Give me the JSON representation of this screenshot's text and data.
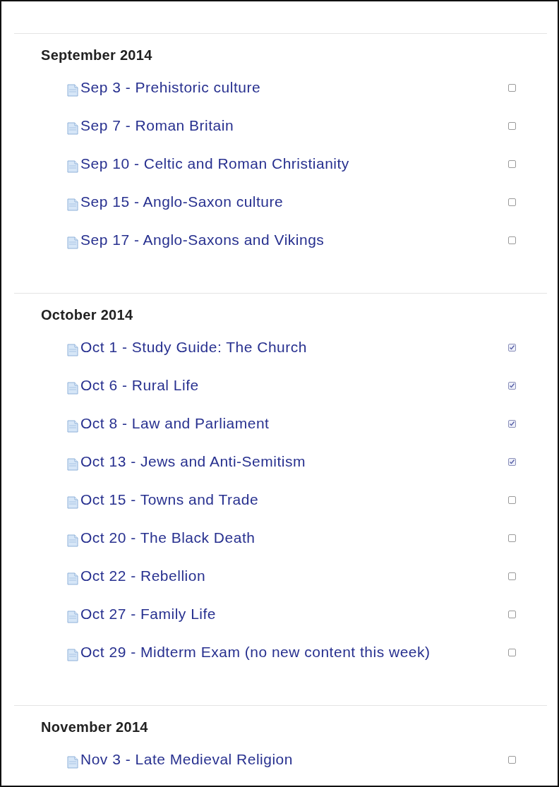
{
  "sections": [
    {
      "heading": "September 2014",
      "items": [
        {
          "title": "Sep 3 - Prehistoric culture",
          "checked": false
        },
        {
          "title": "Sep 7 - Roman Britain",
          "checked": false
        },
        {
          "title": "Sep 10 - Celtic and Roman Christianity",
          "checked": false
        },
        {
          "title": "Sep 15 - Anglo-Saxon culture",
          "checked": false
        },
        {
          "title": "Sep 17 - Anglo-Saxons and Vikings",
          "checked": false
        }
      ]
    },
    {
      "heading": "October 2014",
      "items": [
        {
          "title": "Oct 1 - Study Guide: The Church",
          "checked": true
        },
        {
          "title": "Oct 6 - Rural Life",
          "checked": true
        },
        {
          "title": "Oct 8 - Law and Parliament",
          "checked": true
        },
        {
          "title": "Oct 13 - Jews and Anti-Semitism",
          "checked": true
        },
        {
          "title": "Oct 15 - Towns and Trade",
          "checked": false
        },
        {
          "title": "Oct 20 - The Black Death",
          "checked": false
        },
        {
          "title": "Oct 22 - Rebellion",
          "checked": false
        },
        {
          "title": "Oct 27 - Family Life",
          "checked": false
        },
        {
          "title": "Oct 29 - Midterm Exam (no new content this week)",
          "checked": false
        }
      ]
    },
    {
      "heading": "November 2014",
      "items": [
        {
          "title": "Nov 3 - Late Medieval Religion",
          "checked": false
        }
      ]
    }
  ]
}
